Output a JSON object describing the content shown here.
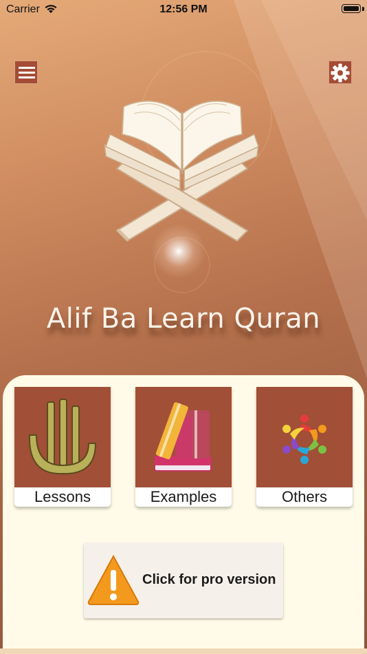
{
  "status_bar": {
    "carrier": "Carrier",
    "time": "12:56 PM"
  },
  "header": {
    "menu_icon": "hamburger-menu-icon",
    "settings_icon": "gear-icon"
  },
  "hero": {
    "image": "quran-book-on-stand",
    "title": "Alif Ba Learn Quran"
  },
  "tiles": [
    {
      "label": "Lessons",
      "icon": "allah-calligraphy-icon"
    },
    {
      "label": "Examples",
      "icon": "books-icon"
    },
    {
      "label": "Others",
      "icon": "colorful-people-circle-icon"
    }
  ],
  "pro_button": {
    "label": "Click for pro version",
    "icon": "warning-icon"
  },
  "colors": {
    "tile_background": "#a14f37",
    "panel_background": "#fffbe8",
    "background_top": "#e5aa78",
    "background_bottom": "#8e553c",
    "warning": "#f39a1e"
  }
}
